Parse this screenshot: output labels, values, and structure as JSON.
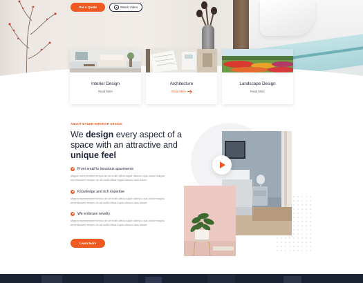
{
  "hero": {
    "quote_label": "Get A Quote",
    "video_label": "Watch Video"
  },
  "services": [
    {
      "title": "Interior Design",
      "link": "Read More"
    },
    {
      "title": "Architecture",
      "link": "Read More"
    },
    {
      "title": "Landscape Design",
      "link": "Read More"
    }
  ],
  "about": {
    "eyebrow": "ABOUT BAUER INTERIOR DESIGN",
    "heading_1": "We ",
    "heading_2": "design",
    "heading_3": " every aspect of a space with an attractive and ",
    "heading_4": "unique feel",
    "features": [
      {
        "title": "From small to luxurious apartments",
        "text": "Magna reprehenderit tempor do sit mollit officia fugiat ullamco duis dolore magna reprehenderit tempor do sit mollit officia fugiat ullamco duis dolore"
      },
      {
        "title": "Knowledge and rich expertise",
        "text": "Magna reprehenderit tempor do sit mollit officia fugiat ullamco duis dolore magna reprehenderit tempor do sit mollit officia fugiat ullamco duis dolore"
      },
      {
        "title": "We embrace novelty",
        "text": "Magna reprehenderit tempor do sit mollit officia fugiat ullamco duis dolore magna reprehenderit tempor do sit mollit officia fugiat ullamco duis dolore"
      }
    ],
    "learn_label": "Learn More"
  },
  "colors": {
    "accent": "#ee5a22",
    "heading": "#1e2438",
    "body_text": "#8a8e98",
    "footer_bg": "#1b2233"
  },
  "icons": [
    "play-circle-icon",
    "check-circle-icon",
    "arrow-right-icon",
    "play-icon"
  ]
}
